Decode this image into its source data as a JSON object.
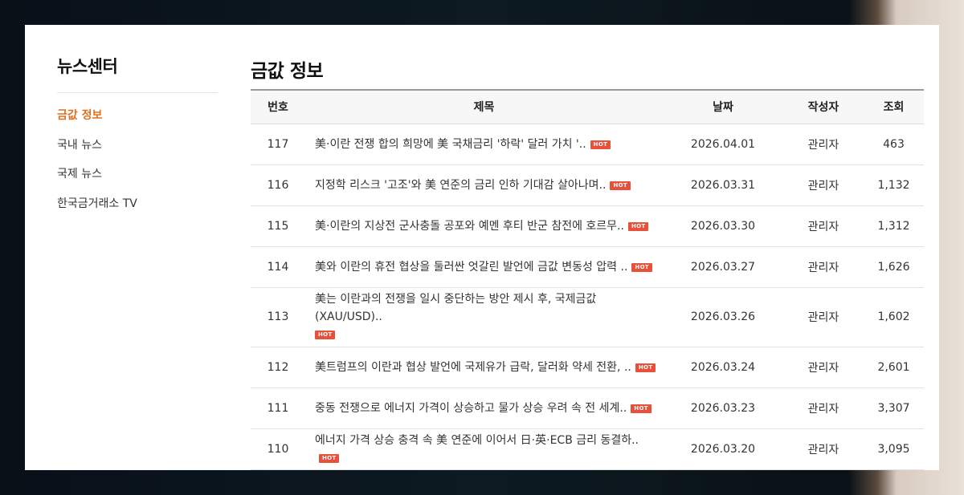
{
  "sidebar": {
    "title": "뉴스센터",
    "items": [
      {
        "label": "금값 정보",
        "active": true
      },
      {
        "label": "국내 뉴스",
        "active": false
      },
      {
        "label": "국제 뉴스",
        "active": false
      },
      {
        "label": "한국금거래소 TV",
        "active": false
      }
    ]
  },
  "main": {
    "title": "금값 정보",
    "table": {
      "headers": {
        "no": "번호",
        "title": "제목",
        "date": "날짜",
        "author": "작성자",
        "views": "조회"
      },
      "hot_label": "HOT",
      "rows": [
        {
          "no": "117",
          "title": "美·이란 전쟁 합의 희망에 美 국채금리 '하락' 달러 가치 '..",
          "date": "2026.04.01",
          "author": "관리자",
          "views": "463"
        },
        {
          "no": "116",
          "title": "지정학 리스크 '고조'와 美 연준의 금리 인하 기대감 살아나며..",
          "date": "2026.03.31",
          "author": "관리자",
          "views": "1,132"
        },
        {
          "no": "115",
          "title": "美·이란의 지상전 군사충돌 공포와 예멘 후티 반군 참전에 호르무..",
          "date": "2026.03.30",
          "author": "관리자",
          "views": "1,312"
        },
        {
          "no": "114",
          "title": "美와 이란의 휴전 협상을 둘러싼 엇갈린 발언에 금값 변동성 압력 ..",
          "date": "2026.03.27",
          "author": "관리자",
          "views": "1,626"
        },
        {
          "no": "113",
          "title": "美는 이란과의 전쟁을 일시 중단하는 방안 제시 후, 국제금값(XAU/USD)..",
          "date": "2026.03.26",
          "author": "관리자",
          "views": "1,602"
        },
        {
          "no": "112",
          "title": "美트럼프의 이란과 협상 발언에 국제유가 급락, 달러화 약세 전환, ..",
          "date": "2026.03.24",
          "author": "관리자",
          "views": "2,601"
        },
        {
          "no": "111",
          "title": "중동 전쟁으로 에너지 가격이 상승하고 물가 상승 우려 속 전 세계..",
          "date": "2026.03.23",
          "author": "관리자",
          "views": "3,307"
        },
        {
          "no": "110",
          "title": "에너지 가격 상승 충격 속 美 연준에 이어서 日·英·ECB 금리 동결하..",
          "date": "2026.03.20",
          "author": "관리자",
          "views": "3,095"
        }
      ]
    }
  }
}
